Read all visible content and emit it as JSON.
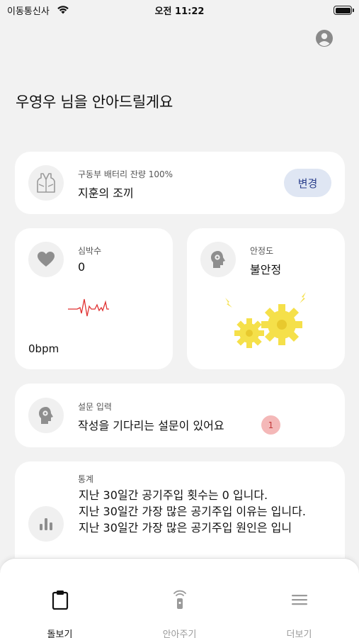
{
  "status_bar": {
    "carrier": "이동통신사",
    "time": "오전 11:22",
    "icons": [
      "wifi-icon",
      "battery-icon"
    ]
  },
  "header": {
    "profile_icon": "person-circle-icon",
    "greeting": "우영우 님을 안아드릴게요"
  },
  "vest_card": {
    "icon": "vest-icon",
    "battery_label": "구동부 배터리 잔량 100%",
    "vest_name": "지훈의 조끼",
    "change_button": "변경"
  },
  "heart_card": {
    "icon": "heart-icon",
    "label": "심박수",
    "value": "0",
    "unit_value": "0bpm",
    "accent_color": "#e03131"
  },
  "stability_card": {
    "icon": "head-gear-icon",
    "label": "안정도",
    "value": "불안정",
    "illustration": "yellow-gears-icon",
    "accent_color": "#f5e04a"
  },
  "survey_card": {
    "icon": "head-gear-icon",
    "label": "설문 입력",
    "message": "작성을 기다리는 설문이 있어요",
    "badge_count": "1"
  },
  "stats_card": {
    "icon": "bar-chart-icon",
    "label": "통계",
    "lines": [
      "지난 30일간 공기주입 횟수는 0 입니다.",
      "지난 30일간 가장 많은 공기주입 이유는  입니다.",
      "지난 30일간 가장 많은 공기주입 원인은  입니"
    ]
  },
  "tabbar": {
    "tabs": [
      {
        "label": "돌보기",
        "icon": "clipboard-icon",
        "active": true
      },
      {
        "label": "안아주기",
        "icon": "remote-signal-icon",
        "active": false
      },
      {
        "label": "더보기",
        "icon": "menu-icon",
        "active": false
      }
    ],
    "active_color": "#111111",
    "inactive_color": "#9a9a9a"
  }
}
